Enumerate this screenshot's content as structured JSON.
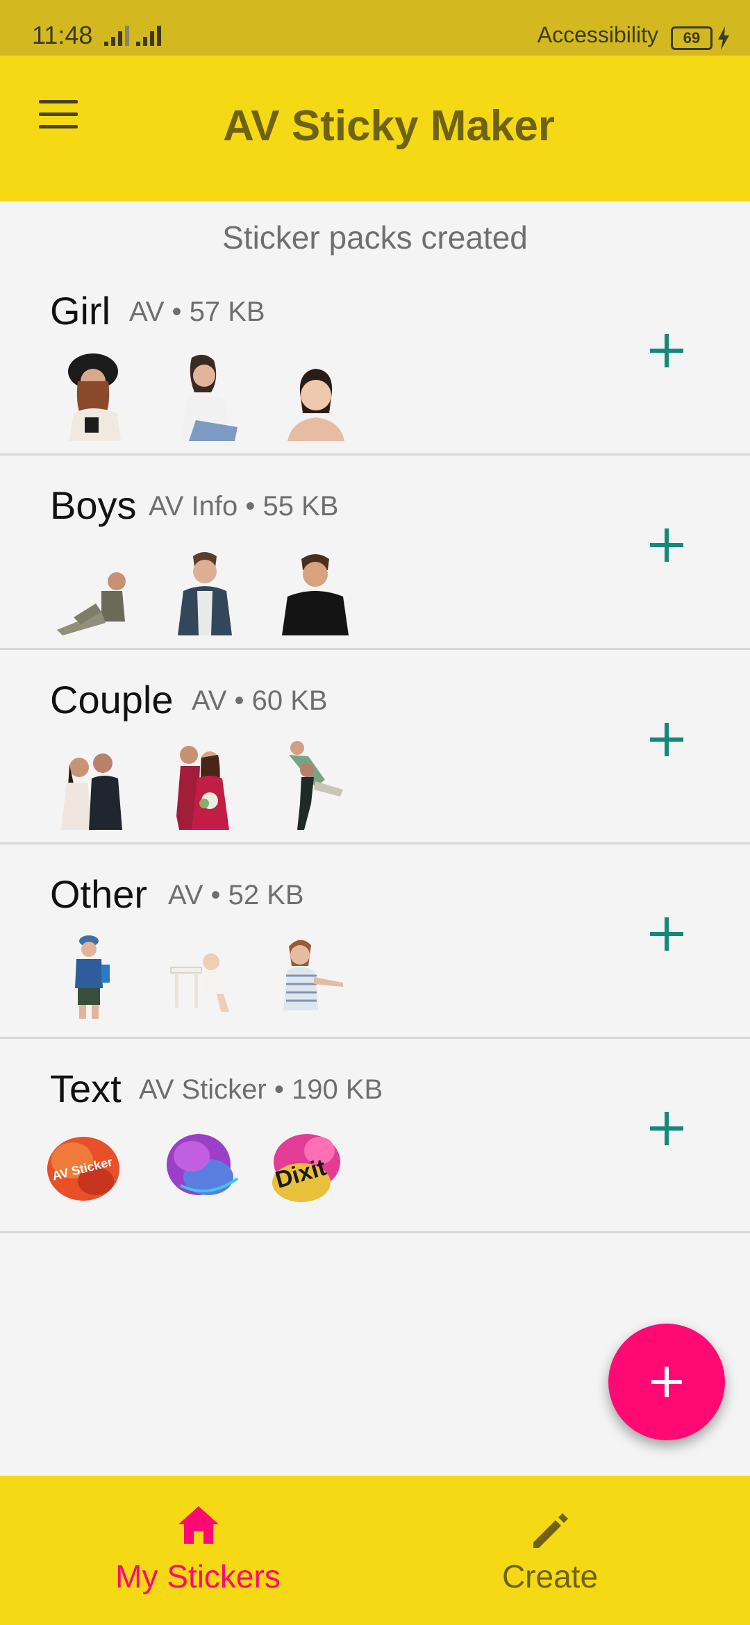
{
  "status": {
    "time": "11:48",
    "accessibility": "Accessibility",
    "battery": "69"
  },
  "app": {
    "title": "AV Sticky Maker",
    "menu_icon": "hamburger-menu-icon"
  },
  "section_title": "Sticker packs created",
  "packs": [
    {
      "name": "Girl",
      "meta": "AV • 57 KB"
    },
    {
      "name": "Boys",
      "meta": "AV Info • 55 KB"
    },
    {
      "name": "Couple",
      "meta": "AV  • 60 KB"
    },
    {
      "name": "Other",
      "meta": "AV • 52 KB"
    },
    {
      "name": "Text",
      "meta": "AV Sticker • 190 KB"
    }
  ],
  "text_stickers": [
    "AV Sticker",
    "",
    "Dixit"
  ],
  "bottom_nav": [
    {
      "label": "My Stickers",
      "icon": "home-icon",
      "active": true
    },
    {
      "label": "Create",
      "icon": "pencil-icon",
      "active": false
    }
  ],
  "colors": {
    "primary": "#f5d914",
    "accent": "#ff0a74",
    "add_icon": "#14897a",
    "title_text": "#6e6314"
  }
}
